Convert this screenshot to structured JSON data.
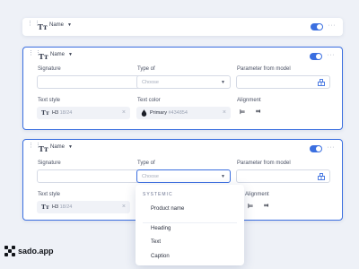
{
  "cards": [
    {
      "header": {
        "name": "Name",
        "toggle_on": true
      }
    },
    {
      "header": {
        "name": "Name",
        "toggle_on": true
      },
      "labels": {
        "signature": "Signature",
        "type_of": "Type of",
        "parameter": "Parameter from model",
        "text_style": "Text style",
        "text_color": "Text color",
        "alignment": "Alignment"
      },
      "type_of_placeholder": "Choose",
      "text_style": {
        "main": "H3",
        "sub": "18/24"
      },
      "text_color": {
        "main": "Primary",
        "sub": "#434854"
      }
    },
    {
      "header": {
        "name": "Name",
        "toggle_on": true
      },
      "labels": {
        "signature": "Signature",
        "type_of": "Type of",
        "parameter": "Parameter from model",
        "text_style": "Text style",
        "alignment": "Alignment"
      },
      "type_of_placeholder": "Choose",
      "text_style": {
        "main": "H3",
        "sub": "18/24"
      }
    }
  ],
  "menu": {
    "section": "SYSTEMIC",
    "items": [
      "Product name",
      "Heading",
      "Text",
      "Caption"
    ]
  },
  "brand": {
    "name": "sado.app"
  },
  "colors": {
    "accent": "#3b6fe0",
    "background": "#eef1f7"
  }
}
